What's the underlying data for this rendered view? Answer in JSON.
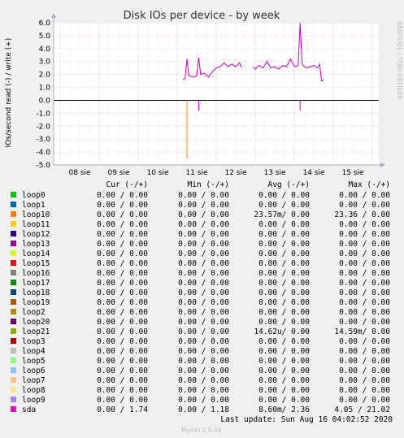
{
  "chart_data": {
    "type": "line",
    "title": "Disk IOs per device - by week",
    "ylabel": "IOs/second read (-) / write (+)",
    "side_label": "RRDTOOL / TOBI OETIKER",
    "ylim": [
      -5.0,
      6.0
    ],
    "yticks": [
      "6.0",
      "5.0",
      "4.0",
      "3.0",
      "2.0",
      "1.0",
      "0.0",
      "-1.0",
      "-2.0",
      "-3.0",
      "-4.0",
      "-5.0"
    ],
    "x_categories": [
      "08 sie",
      "09 sie",
      "10 sie",
      "11 sie",
      "12 sie",
      "13 sie",
      "14 sie",
      "15 sie"
    ],
    "grid": true,
    "series": [
      {
        "name": "loop10",
        "color": "#ff8000",
        "read_spike": {
          "day": 3.25,
          "value": -4.5
        }
      },
      {
        "name": "sda",
        "color": "#cc00cc",
        "write": [
          [
            3.15,
            1.6
          ],
          [
            3.2,
            1.7
          ],
          [
            3.25,
            3.2
          ],
          [
            3.3,
            1.9
          ],
          [
            3.4,
            1.8
          ],
          [
            3.5,
            1.9
          ],
          [
            3.55,
            3.3
          ],
          [
            3.6,
            2.0
          ],
          [
            3.7,
            2.1
          ],
          [
            3.8,
            1.8
          ],
          [
            3.9,
            2.2
          ],
          [
            4.0,
            2.5
          ],
          [
            4.1,
            2.6
          ],
          [
            4.2,
            2.9
          ],
          [
            4.3,
            2.6
          ],
          [
            4.4,
            2.8
          ],
          [
            4.5,
            2.6
          ],
          [
            4.6,
            2.9
          ],
          [
            4.65,
            2.5
          ],
          [
            4.95,
            2.6
          ],
          [
            5.0,
            2.4
          ],
          [
            5.1,
            2.7
          ],
          [
            5.2,
            2.5
          ],
          [
            5.3,
            3.0
          ],
          [
            5.4,
            2.5
          ],
          [
            5.5,
            2.6
          ],
          [
            5.6,
            2.4
          ],
          [
            5.7,
            2.7
          ],
          [
            5.8,
            2.6
          ],
          [
            5.9,
            3.2
          ],
          [
            6.0,
            2.6
          ],
          [
            6.1,
            2.7
          ],
          [
            6.15,
            6.0
          ],
          [
            6.2,
            2.8
          ],
          [
            6.3,
            2.5
          ],
          [
            6.4,
            2.6
          ],
          [
            6.5,
            2.7
          ],
          [
            6.6,
            2.5
          ],
          [
            6.65,
            2.8
          ],
          [
            6.7,
            1.5
          ],
          [
            6.75,
            1.6
          ]
        ],
        "read": [
          [
            3.55,
            -0.8
          ],
          [
            6.15,
            -0.8
          ]
        ]
      }
    ]
  },
  "table": {
    "headers": [
      "Cur (-/+)",
      "Min (-/+)",
      "Avg (-/+)",
      "Max (-/+)"
    ],
    "rows": [
      {
        "name": "loop0",
        "color": "#00cc00",
        "cur": "0.00 /  0.00",
        "min": "0.00 /  0.00",
        "avg": "0.00 /  0.00",
        "max": "0.00 /  0.00"
      },
      {
        "name": "loop1",
        "color": "#0066b3",
        "cur": "0.00 /  0.00",
        "min": "0.00 /  0.00",
        "avg": "0.00 /  0.00",
        "max": "0.00 /  0.00"
      },
      {
        "name": "loop10",
        "color": "#ff8000",
        "cur": "0.00 /  0.00",
        "min": "0.00 /  0.00",
        "avg": "23.57m/  0.00",
        "max": "23.36 /  0.00"
      },
      {
        "name": "loop11",
        "color": "#ffcc00",
        "cur": "0.00 /  0.00",
        "min": "0.00 /  0.00",
        "avg": "0.00 /  0.00",
        "max": "0.00 /  0.00"
      },
      {
        "name": "loop12",
        "color": "#330099",
        "cur": "0.00 /  0.00",
        "min": "0.00 /  0.00",
        "avg": "0.00 /  0.00",
        "max": "0.00 /  0.00"
      },
      {
        "name": "loop13",
        "color": "#990099",
        "cur": "0.00 /  0.00",
        "min": "0.00 /  0.00",
        "avg": "0.00 /  0.00",
        "max": "0.00 /  0.00"
      },
      {
        "name": "loop14",
        "color": "#ccff00",
        "cur": "0.00 /  0.00",
        "min": "0.00 /  0.00",
        "avg": "0.00 /  0.00",
        "max": "0.00 /  0.00"
      },
      {
        "name": "loop15",
        "color": "#ff0000",
        "cur": "0.00 /  0.00",
        "min": "0.00 /  0.00",
        "avg": "0.00 /  0.00",
        "max": "0.00 /  0.00"
      },
      {
        "name": "loop16",
        "color": "#808080",
        "cur": "0.00 /  0.00",
        "min": "0.00 /  0.00",
        "avg": "0.00 /  0.00",
        "max": "0.00 /  0.00"
      },
      {
        "name": "loop17",
        "color": "#008f00",
        "cur": "0.00 /  0.00",
        "min": "0.00 /  0.00",
        "avg": "0.00 /  0.00",
        "max": "0.00 /  0.00"
      },
      {
        "name": "loop18",
        "color": "#00487d",
        "cur": "0.00 /  0.00",
        "min": "0.00 /  0.00",
        "avg": "0.00 /  0.00",
        "max": "0.00 /  0.00"
      },
      {
        "name": "loop19",
        "color": "#b35a00",
        "cur": "0.00 /  0.00",
        "min": "0.00 /  0.00",
        "avg": "0.00 /  0.00",
        "max": "0.00 /  0.00"
      },
      {
        "name": "loop2",
        "color": "#b38f00",
        "cur": "0.00 /  0.00",
        "min": "0.00 /  0.00",
        "avg": "0.00 /  0.00",
        "max": "0.00 /  0.00"
      },
      {
        "name": "loop20",
        "color": "#6b006b",
        "cur": "0.00 /  0.00",
        "min": "0.00 /  0.00",
        "avg": "0.00 /  0.00",
        "max": "0.00 /  0.00"
      },
      {
        "name": "loop21",
        "color": "#8fb300",
        "cur": "0.00 /  0.00",
        "min": "0.00 /  0.00",
        "avg": "14.62u/  0.00",
        "max": "14.59m/  0.00"
      },
      {
        "name": "loop3",
        "color": "#b30000",
        "cur": "0.00 /  0.00",
        "min": "0.00 /  0.00",
        "avg": "0.00 /  0.00",
        "max": "0.00 /  0.00"
      },
      {
        "name": "loop4",
        "color": "#bebebe",
        "cur": "0.00 /  0.00",
        "min": "0.00 /  0.00",
        "avg": "0.00 /  0.00",
        "max": "0.00 /  0.00"
      },
      {
        "name": "loop5",
        "color": "#80ff80",
        "cur": "0.00 /  0.00",
        "min": "0.00 /  0.00",
        "avg": "0.00 /  0.00",
        "max": "0.00 /  0.00"
      },
      {
        "name": "loop6",
        "color": "#80c9ff",
        "cur": "0.00 /  0.00",
        "min": "0.00 /  0.00",
        "avg": "0.00 /  0.00",
        "max": "0.00 /  0.00"
      },
      {
        "name": "loop7",
        "color": "#ffc080",
        "cur": "0.00 /  0.00",
        "min": "0.00 /  0.00",
        "avg": "0.00 /  0.00",
        "max": "0.00 /  0.00"
      },
      {
        "name": "loop8",
        "color": "#ffe680",
        "cur": "0.00 /  0.00",
        "min": "0.00 /  0.00",
        "avg": "0.00 /  0.00",
        "max": "0.00 /  0.00"
      },
      {
        "name": "loop9",
        "color": "#aa80ff",
        "cur": "0.00 /  0.00",
        "min": "0.00 /  0.00",
        "avg": "0.00 /  0.00",
        "max": "0.00 /  0.00"
      },
      {
        "name": "sda",
        "color": "#ee00cc",
        "cur": "0.00 /  1.74",
        "min": "0.00 /  1.18",
        "avg": "8.60m/  2.36",
        "max": "4.05 / 21.02"
      }
    ]
  },
  "footer": {
    "last_update": "Last update: Sun Aug 16 04:02:52 2020",
    "version": "Munin 2.0.49"
  }
}
